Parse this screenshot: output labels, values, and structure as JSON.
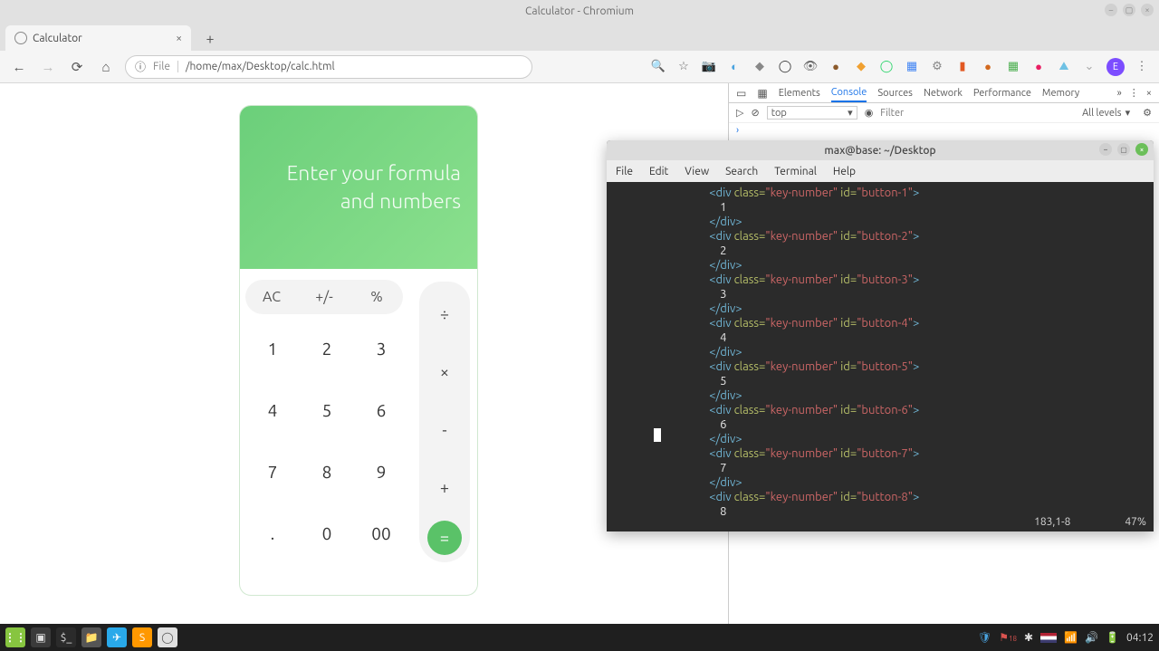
{
  "window": {
    "title": "Calculator - Chromium"
  },
  "tab": {
    "title": "Calculator"
  },
  "toolbar": {
    "scheme_label": "File",
    "path": "/home/max/Desktop/calc.html",
    "info_icon": "ⓘ",
    "avatar_letter": "E"
  },
  "calculator": {
    "display_line1": "Enter your formula",
    "display_line2": "and numbers",
    "keys": {
      "ac": "AC",
      "sign": "+/-",
      "pct": "%",
      "d1": "1",
      "d2": "2",
      "d3": "3",
      "d4": "4",
      "d5": "5",
      "d6": "6",
      "d7": "7",
      "d8": "8",
      "d9": "9",
      "dot": ".",
      "d0": "0",
      "d00": "00",
      "div": "÷",
      "mul": "×",
      "sub": "-",
      "add": "+",
      "eq": "="
    }
  },
  "devtools": {
    "tabs": [
      "Elements",
      "Console",
      "Sources",
      "Network",
      "Performance",
      "Memory"
    ],
    "active_tab": "Console",
    "context": "top",
    "filter_placeholder": "Filter",
    "levels_label": "All levels",
    "prompt": "›"
  },
  "terminal": {
    "title": "max@base: ~/Desktop",
    "menu": [
      "File",
      "Edit",
      "View",
      "Search",
      "Terminal",
      "Help"
    ],
    "status_pos": "183,1-8",
    "status_pct": "47%",
    "code_rows": [
      {
        "class": "key-number",
        "id": "button-1",
        "txt": "1"
      },
      {
        "class": "key-number",
        "id": "button-2",
        "txt": "2"
      },
      {
        "class": "key-number",
        "id": "button-3",
        "txt": "3"
      },
      {
        "class": "key-number",
        "id": "button-4",
        "txt": "4"
      },
      {
        "class": "key-number",
        "id": "button-5",
        "txt": "5"
      },
      {
        "class": "key-number",
        "id": "button-6",
        "txt": "6"
      },
      {
        "class": "key-number",
        "id": "button-7",
        "txt": "7"
      },
      {
        "class": "key-number",
        "id": "button-8",
        "txt": "8"
      }
    ]
  },
  "taskbar": {
    "date_badge": "18",
    "clock": "04:12"
  }
}
